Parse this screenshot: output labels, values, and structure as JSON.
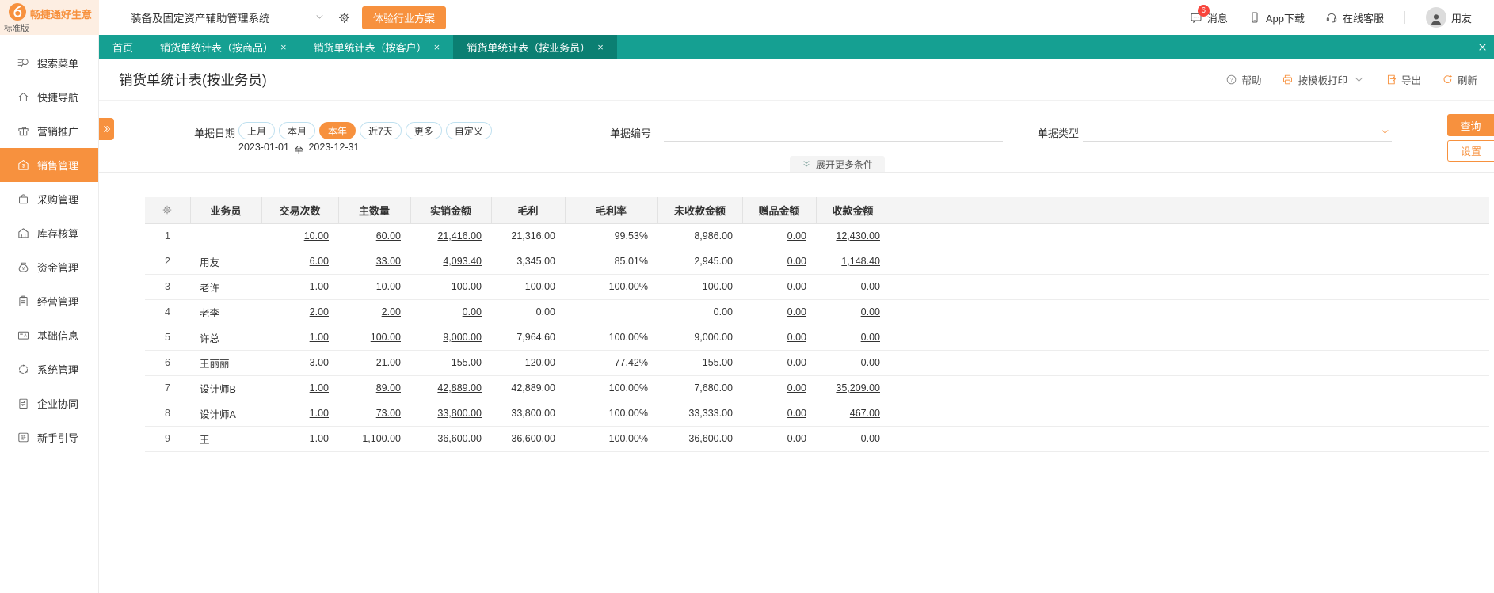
{
  "topbar": {
    "brand": "畅捷通好生意",
    "edition": "标准版",
    "system_select": "装备及固定资产辅助管理系统",
    "trial_button": "体验行业方案",
    "message_label": "消息",
    "message_badge": "6",
    "app_download_label": "App下载",
    "online_service_label": "在线客服",
    "user_label": "用友"
  },
  "tabs": [
    {
      "label": "首页",
      "closable": false,
      "active": false
    },
    {
      "label": "销货单统计表（按商品）",
      "closable": true,
      "active": false
    },
    {
      "label": "销货单统计表（按客户）",
      "closable": true,
      "active": false
    },
    {
      "label": "销货单统计表（按业务员）",
      "closable": true,
      "active": true
    }
  ],
  "sidebar": [
    {
      "label": "搜索菜单",
      "icon": "search-menu",
      "active": false
    },
    {
      "label": "快捷导航",
      "icon": "quick-nav",
      "active": false
    },
    {
      "label": "营销推广",
      "icon": "marketing",
      "active": false
    },
    {
      "label": "销售管理",
      "icon": "sales",
      "active": true
    },
    {
      "label": "采购管理",
      "icon": "purchase",
      "active": false
    },
    {
      "label": "库存核算",
      "icon": "inventory",
      "active": false
    },
    {
      "label": "资金管理",
      "icon": "funds",
      "active": false
    },
    {
      "label": "经营管理",
      "icon": "operations",
      "active": false
    },
    {
      "label": "基础信息",
      "icon": "base-info",
      "active": false
    },
    {
      "label": "系统管理",
      "icon": "system",
      "active": false
    },
    {
      "label": "企业协同",
      "icon": "enterprise",
      "active": false
    },
    {
      "label": "新手引导",
      "icon": "newbie",
      "active": false
    }
  ],
  "page": {
    "title": "销货单统计表(按业务员)",
    "actions": {
      "help": "帮助",
      "print": "按模板打印",
      "export": "导出",
      "refresh": "刷新"
    }
  },
  "filters": {
    "date_label": "单据日期",
    "date_options": [
      "上月",
      "本月",
      "本年",
      "近7天",
      "更多",
      "自定义"
    ],
    "date_active": "本年",
    "date_range": {
      "start": "2023-01-01",
      "sep": "至",
      "end": "2023-12-31"
    },
    "doc_no_label": "单据编号",
    "doc_no_value": "",
    "doc_type_label": "单据类型",
    "doc_type_value": "",
    "search_button": "查询",
    "settings_button": "设置",
    "expand_more": "展开更多条件"
  },
  "table": {
    "columns": [
      "业务员",
      "交易次数",
      "主数量",
      "实销金额",
      "毛利",
      "毛利率",
      "未收款金额",
      "赠品金额",
      "收款金额"
    ],
    "link_columns": [
      2,
      3,
      4,
      8,
      9
    ],
    "rows": [
      [
        "1",
        "",
        "10.00",
        "60.00",
        "21,416.00",
        "21,316.00",
        "99.53%",
        "8,986.00",
        "0.00",
        "12,430.00"
      ],
      [
        "2",
        "用友",
        "6.00",
        "33.00",
        "4,093.40",
        "3,345.00",
        "85.01%",
        "2,945.00",
        "0.00",
        "1,148.40"
      ],
      [
        "3",
        "老许",
        "1.00",
        "10.00",
        "100.00",
        "100.00",
        "100.00%",
        "100.00",
        "0.00",
        "0.00"
      ],
      [
        "4",
        "老李",
        "2.00",
        "2.00",
        "0.00",
        "0.00",
        "",
        "0.00",
        "0.00",
        "0.00"
      ],
      [
        "5",
        "许总",
        "1.00",
        "100.00",
        "9,000.00",
        "7,964.60",
        "100.00%",
        "9,000.00",
        "0.00",
        "0.00"
      ],
      [
        "6",
        "王丽丽",
        "3.00",
        "21.00",
        "155.00",
        "120.00",
        "77.42%",
        "155.00",
        "0.00",
        "0.00"
      ],
      [
        "7",
        "设计师B",
        "1.00",
        "89.00",
        "42,889.00",
        "42,889.00",
        "100.00%",
        "7,680.00",
        "0.00",
        "35,209.00"
      ],
      [
        "8",
        "设计师A",
        "1.00",
        "73.00",
        "33,800.00",
        "33,800.00",
        "100.00%",
        "33,333.00",
        "0.00",
        "467.00"
      ],
      [
        "9",
        "王",
        "1.00",
        "1,100.00",
        "36,600.00",
        "36,600.00",
        "100.00%",
        "36,600.00",
        "0.00",
        "0.00"
      ]
    ]
  },
  "colors": {
    "teal": "#15a092",
    "teal_active_tab": "#0b7f72",
    "orange": "#f7913e",
    "badge_red": "#f8453c",
    "logo_cream": "#fdeee2",
    "table_header_bg": "#f4f4f4"
  }
}
